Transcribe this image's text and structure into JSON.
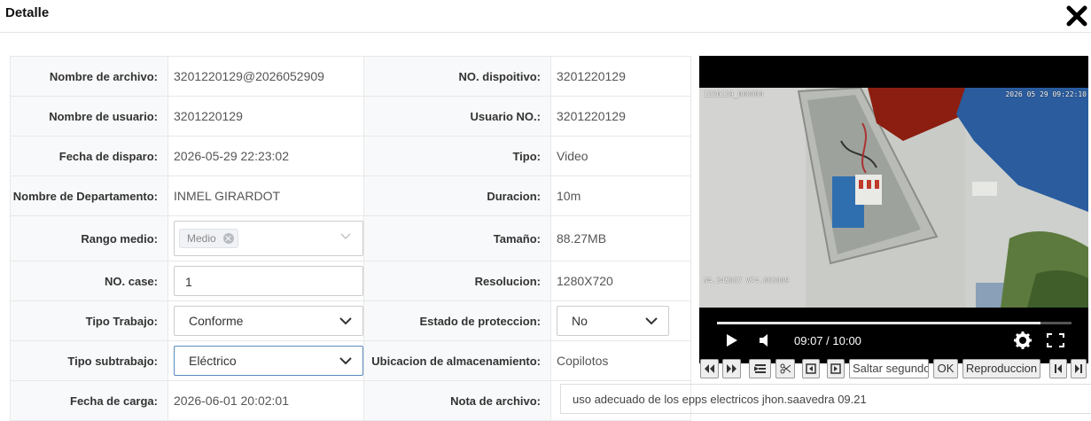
{
  "dialog": {
    "title": "Detalle"
  },
  "rows": {
    "r0": {
      "l1": "Nombre de archivo:",
      "v1": "3201220129@2026052909",
      "l2": "NO. dispoitivo:",
      "v2": "3201220129"
    },
    "r1": {
      "l1": "Nombre de usuario:",
      "v1": "3201220129",
      "l2": "Usuario NO.:",
      "v2": "3201220129"
    },
    "r2": {
      "l1": "Fecha de disparo:",
      "v1": "2026-05-29 22:23:02",
      "l2": "Tipo:",
      "v2": "Video"
    },
    "r3": {
      "l1": "Nombre de Departamento:",
      "v1": "INMEL GIRARDOT",
      "l2": "Duracion:",
      "v2": "10m"
    },
    "r4": {
      "l1": "Rango medio:",
      "tag": "Medio",
      "l2": "Tamaño:",
      "v2": "88.27MB"
    },
    "r5": {
      "l1": "NO. case:",
      "input": "1",
      "l2": "Resolucion:",
      "v2": "1280X720"
    },
    "r6": {
      "l1": "Tipo Trabajo:",
      "select": "Conforme",
      "l2": "Estado de proteccion:",
      "select2": "No"
    },
    "r7": {
      "l1": "Tipo subtrabajo:",
      "select": "Eléctrico",
      "l2": "Ubicacion de almacenamiento:",
      "v2": "Copilotos"
    },
    "r8": {
      "l1": "Fecha de carga:",
      "v1": "2026-06-01 20:02:01",
      "l2": "Nota de archivo:",
      "note": "uso adecuado de los epps electricos jhon.saavedra 09.21"
    }
  },
  "player": {
    "osd_top_left": "1220129_000000",
    "osd_top_right": "2026 05 29 09:22:10",
    "osd_bottom_left": "N4.345037 W74.803009",
    "time": "09:07 / 10:00",
    "progress": 0.912
  },
  "toolbar": {
    "seek_placeholder": "Saltar segundo",
    "ok": "OK",
    "playback": "Reproduccion"
  },
  "icons": [
    "close-icon",
    "rewind-icon",
    "fast-forward-icon",
    "list-icon",
    "scissors-icon",
    "prev-frame-icon",
    "next-frame-icon",
    "skip-start-icon",
    "skip-end-icon",
    "play-icon",
    "volume-icon",
    "settings-icon",
    "fullscreen-icon",
    "chevron-down-icon"
  ]
}
